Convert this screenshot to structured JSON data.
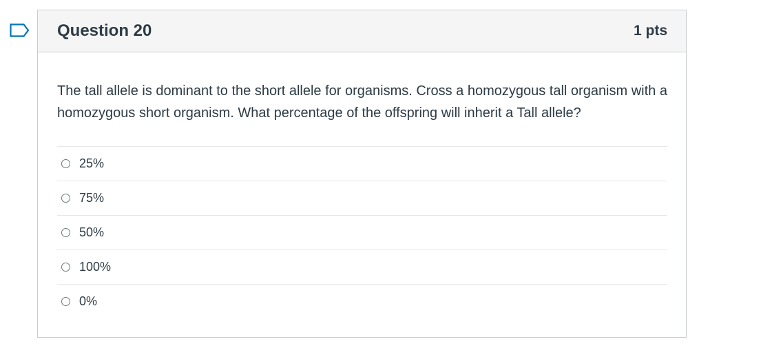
{
  "question": {
    "title": "Question 20",
    "points": "1 pts",
    "text": "The tall allele is dominant to the short allele for organisms. Cross a homozygous tall organism with a homozygous short organism. What percentage of the offspring will inherit a Tall allele?",
    "answers": [
      {
        "label": "25%",
        "selected": false
      },
      {
        "label": "75%",
        "selected": false
      },
      {
        "label": "50%",
        "selected": false
      },
      {
        "label": "100%",
        "selected": false
      },
      {
        "label": "0%",
        "selected": false
      }
    ]
  },
  "flag": {
    "icon": "bookmark-flag-icon",
    "color": "#0374b5"
  }
}
